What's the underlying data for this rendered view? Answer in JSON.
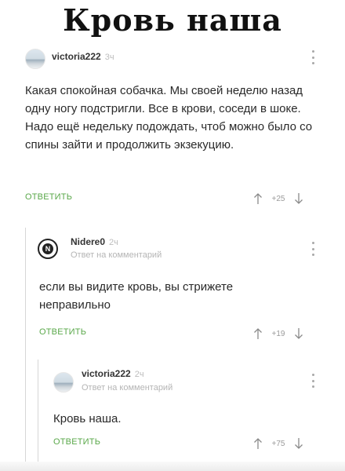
{
  "meme_title": "Кровь наша",
  "comments": [
    {
      "username": "victoria222",
      "time": "3ч",
      "reply_to": "",
      "avatar": "landscape-avatar",
      "text": "Какая спокойная собачка. Мы своей неделю назад одну ногу подстригли. Все в крови, соседи в шоке. Надо ещё недельку подождать, чтоб можно было со спины зайти и продолжить экзекуцию.",
      "reply_label": "ОТВЕТИТЬ",
      "votes": "+25"
    },
    {
      "username": "Nidere0",
      "time": "2ч",
      "reply_to": "Ответ на комментарий",
      "avatar": "letter-n-avatar",
      "avatar_letter": "N",
      "text": "если вы видите кровь, вы стрижете неправильно",
      "reply_label": "ОТВЕТИТЬ",
      "votes": "+19"
    },
    {
      "username": "victoria222",
      "time": "2ч",
      "reply_to": "Ответ на комментарий",
      "avatar": "landscape-avatar",
      "text": "Кровь наша.",
      "reply_label": "ОТВЕТИТЬ",
      "votes": "+75"
    }
  ],
  "icons": [
    "more-vertical-icon",
    "arrow-up-icon",
    "arrow-down-icon"
  ],
  "colors": {
    "reply": "#5aa84a",
    "muted": "#b5b5b5",
    "thread_line": "#d6d6d6"
  }
}
